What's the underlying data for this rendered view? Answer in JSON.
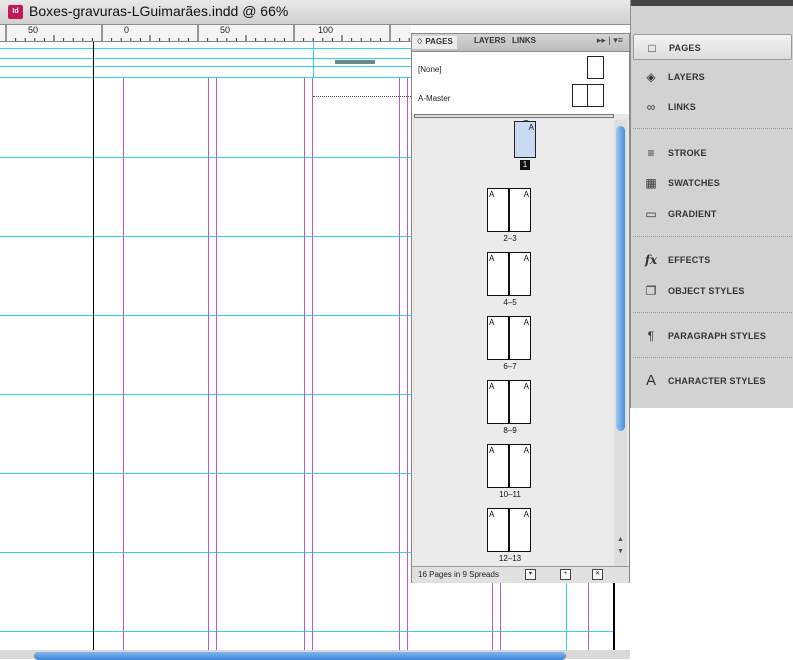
{
  "document": {
    "title": "Boxes-gravuras-LGuimarães.indd @ 66%",
    "icon": "indesign-document-icon",
    "ruler_numbers": [
      "50",
      "0",
      "50",
      "100"
    ]
  },
  "pages_panel": {
    "tabs": [
      {
        "label": "♢ PAGES",
        "active": true
      },
      {
        "label": "LAYERS",
        "active": false
      },
      {
        "label": "LINKS",
        "active": false
      }
    ],
    "menu_glyph": "▸▸ | ▾≡",
    "masters": [
      {
        "label": "[None]"
      },
      {
        "label": "A-Master"
      }
    ],
    "first_page": {
      "master_letter": "A",
      "number": "1"
    },
    "spreads": [
      {
        "label": "2–3",
        "left": "A",
        "right": "A"
      },
      {
        "label": "4–5",
        "left": "A",
        "right": "A"
      },
      {
        "label": "6–7",
        "left": "A",
        "right": "A"
      },
      {
        "label": "8–9",
        "left": "A",
        "right": "A"
      },
      {
        "label": "10–11",
        "left": "A",
        "right": "A"
      },
      {
        "label": "12–13",
        "left": "A",
        "right": "A"
      }
    ],
    "footer": "16 Pages in 9 Spreads"
  },
  "dock": {
    "items": [
      {
        "label": "PAGES",
        "icon": "pages-icon",
        "glyph": "□",
        "active": true
      },
      {
        "label": "LAYERS",
        "icon": "layers-icon",
        "glyph": "◈",
        "active": false
      },
      {
        "label": "LINKS",
        "icon": "links-icon",
        "glyph": "∞",
        "active": false
      },
      {
        "label": "STROKE",
        "icon": "stroke-icon",
        "glyph": "≡",
        "active": false
      },
      {
        "label": "SWATCHES",
        "icon": "swatches-icon",
        "glyph": "▦",
        "active": false
      },
      {
        "label": "GRADIENT",
        "icon": "gradient-icon",
        "glyph": "▭",
        "active": false
      },
      {
        "label": "EFFECTS",
        "icon": "effects-icon",
        "glyph": "fx",
        "active": false
      },
      {
        "label": "OBJECT STYLES",
        "icon": "object-styles-icon",
        "glyph": "❐",
        "active": false
      },
      {
        "label": "PARAGRAPH STYLES",
        "icon": "paragraph-styles-icon",
        "glyph": "¶",
        "active": false
      },
      {
        "label": "CHARACTER STYLES",
        "icon": "character-styles-icon",
        "glyph": "A",
        "active": false
      }
    ]
  }
}
